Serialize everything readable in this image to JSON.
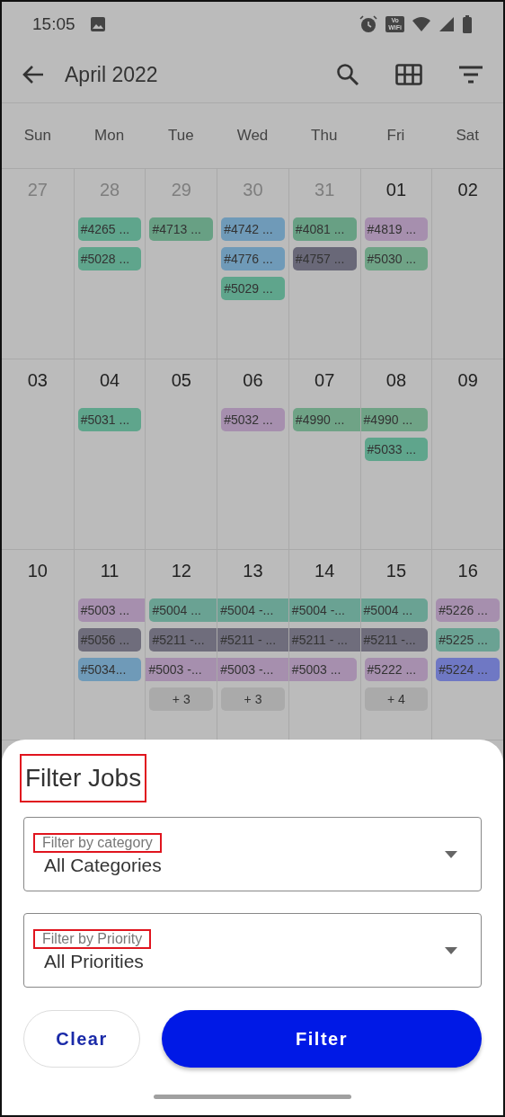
{
  "status_bar": {
    "time": "15:05",
    "vowifi": [
      "Vo",
      "WiFi"
    ]
  },
  "app_bar": {
    "title": "April 2022"
  },
  "weekdays": [
    "Sun",
    "Mon",
    "Tue",
    "Wed",
    "Thu",
    "Fri",
    "Sat"
  ],
  "weeks": [
    {
      "days": [
        {
          "date": "27",
          "muted": true
        },
        {
          "date": "28",
          "muted": true,
          "events": [
            {
              "kind": "single",
              "label": "#4265 ...",
              "color": "#5fa58c"
            },
            {
              "kind": "single",
              "label": "#5028 ...",
              "color": "#5fa58c"
            }
          ]
        },
        {
          "date": "29",
          "muted": true,
          "events": [
            {
              "kind": "single",
              "label": "#4713 ...",
              "color": "#68a084"
            }
          ]
        },
        {
          "date": "30",
          "muted": true,
          "events": [
            {
              "kind": "single",
              "label": "#4742 ...",
              "color": "#6f9ab8"
            },
            {
              "kind": "single",
              "label": "#4776 ...",
              "color": "#6f9ab8"
            },
            {
              "kind": "single",
              "label": "#5029 ...",
              "color": "#5fa58c"
            }
          ]
        },
        {
          "date": "31",
          "muted": true,
          "events": [
            {
              "kind": "single",
              "label": "#4081 ...",
              "color": "#68a084"
            },
            {
              "kind": "single",
              "label": "#4757 ...",
              "color": "#696878"
            }
          ]
        },
        {
          "date": "01",
          "muted": false,
          "events": [
            {
              "kind": "single",
              "label": "#4819 ...",
              "color": "#a68fae"
            },
            {
              "kind": "single",
              "label": "#5030 ...",
              "color": "#6fa386"
            }
          ]
        },
        {
          "date": "02",
          "muted": false
        }
      ]
    },
    {
      "days": [
        {
          "date": "03",
          "muted": false
        },
        {
          "date": "04",
          "muted": false,
          "events": [
            {
              "kind": "single",
              "label": "#5031 ...",
              "color": "#5fa58c"
            }
          ]
        },
        {
          "date": "05",
          "muted": false
        },
        {
          "date": "06",
          "muted": false,
          "events": [
            {
              "kind": "single",
              "label": "#5032 ...",
              "color": "#a68fae"
            }
          ]
        },
        {
          "date": "07",
          "muted": false,
          "events": [
            {
              "kind": "start",
              "label": "#4990 ...",
              "color": "#6fa386"
            }
          ]
        },
        {
          "date": "08",
          "muted": false,
          "events": [
            {
              "kind": "end",
              "label": "#4990 ...",
              "color": "#6fa386"
            },
            {
              "kind": "single",
              "label": "#5033 ...",
              "color": "#5fa58c"
            }
          ]
        },
        {
          "date": "09",
          "muted": false
        }
      ]
    },
    {
      "days": [
        {
          "date": "10",
          "muted": false
        },
        {
          "date": "11",
          "muted": false,
          "events": [
            {
              "kind": "start",
              "label": "#5003 ...",
              "color": "#a68fae"
            },
            {
              "kind": "single",
              "label": "#5056 ...",
              "color": "#6f6d7c"
            },
            {
              "kind": "single",
              "label": "#5034...",
              "color": "#6f9ab8"
            }
          ]
        },
        {
          "date": "12",
          "muted": false,
          "events": [
            {
              "kind": "start",
              "label": "#5004 ...",
              "color": "#6aa293"
            },
            {
              "kind": "start",
              "label": "#5211 -...",
              "color": "#6f6d7c"
            },
            {
              "kind": "middle",
              "label": "#5003 -...",
              "color": "#a68fae"
            },
            {
              "kind": "more",
              "label": "+ 3"
            }
          ]
        },
        {
          "date": "13",
          "muted": false,
          "events": [
            {
              "kind": "middle",
              "label": "#5004 -...",
              "color": "#6aa293"
            },
            {
              "kind": "middle",
              "label": "#5211 - ...",
              "color": "#6f6d7c"
            },
            {
              "kind": "middle",
              "label": "#5003 -...",
              "color": "#a68fae"
            },
            {
              "kind": "more",
              "label": "+ 3"
            }
          ]
        },
        {
          "date": "14",
          "muted": false,
          "events": [
            {
              "kind": "middle",
              "label": "#5004 -...",
              "color": "#6aa293"
            },
            {
              "kind": "middle",
              "label": "#5211 - ...",
              "color": "#6f6d7c"
            },
            {
              "kind": "end",
              "label": "#5003 ...",
              "color": "#a68fae"
            }
          ]
        },
        {
          "date": "15",
          "muted": false,
          "events": [
            {
              "kind": "end",
              "label": "#5004 ...",
              "color": "#6aa293"
            },
            {
              "kind": "end",
              "label": "#5211 -...",
              "color": "#6f6d7c"
            },
            {
              "kind": "single",
              "label": "#5222 ...",
              "color": "#a68fae"
            },
            {
              "kind": "more",
              "label": "+ 4"
            }
          ]
        },
        {
          "date": "16",
          "muted": false,
          "events": [
            {
              "kind": "single",
              "label": "#5226 ...",
              "color": "#a68fae"
            },
            {
              "kind": "single",
              "label": "#5225 ...",
              "color": "#6aa293"
            },
            {
              "kind": "single",
              "label": "#5224 ...",
              "color": "#6f78c4"
            }
          ]
        }
      ]
    }
  ],
  "sheet": {
    "title": {
      "text": "Filter Jobs",
      "highlighted": true
    },
    "dropdowns": [
      {
        "label": "Filter by category",
        "label_highlighted": true,
        "value": "All Categories"
      },
      {
        "label": "Filter by Priority",
        "label_highlighted": true,
        "value": "All Priorities"
      }
    ],
    "buttons": [
      {
        "kind": "secondary",
        "label": "Clear"
      },
      {
        "kind": "primary",
        "label": "Filter"
      }
    ]
  }
}
